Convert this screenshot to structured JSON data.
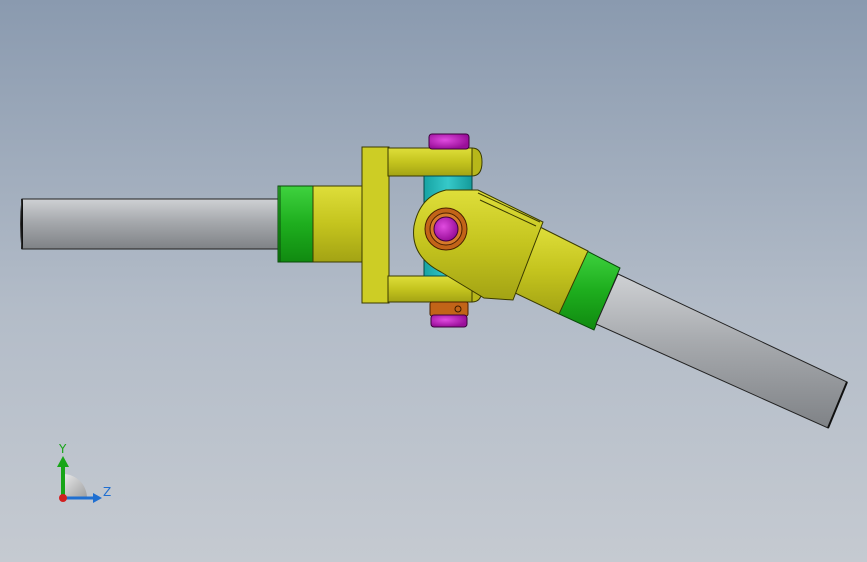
{
  "triad": {
    "y_label": "Y",
    "z_label": "Z"
  },
  "colors": {
    "shaft": "#a8abaf",
    "collar": "#22bb22",
    "yoke": "#c8c820",
    "cross_body": "#22b7b7",
    "pin": "#c21ac2",
    "nut": "#c26418",
    "axis_y": "#17a517",
    "axis_z": "#1f6fd1",
    "origin": "#d11f1f"
  }
}
